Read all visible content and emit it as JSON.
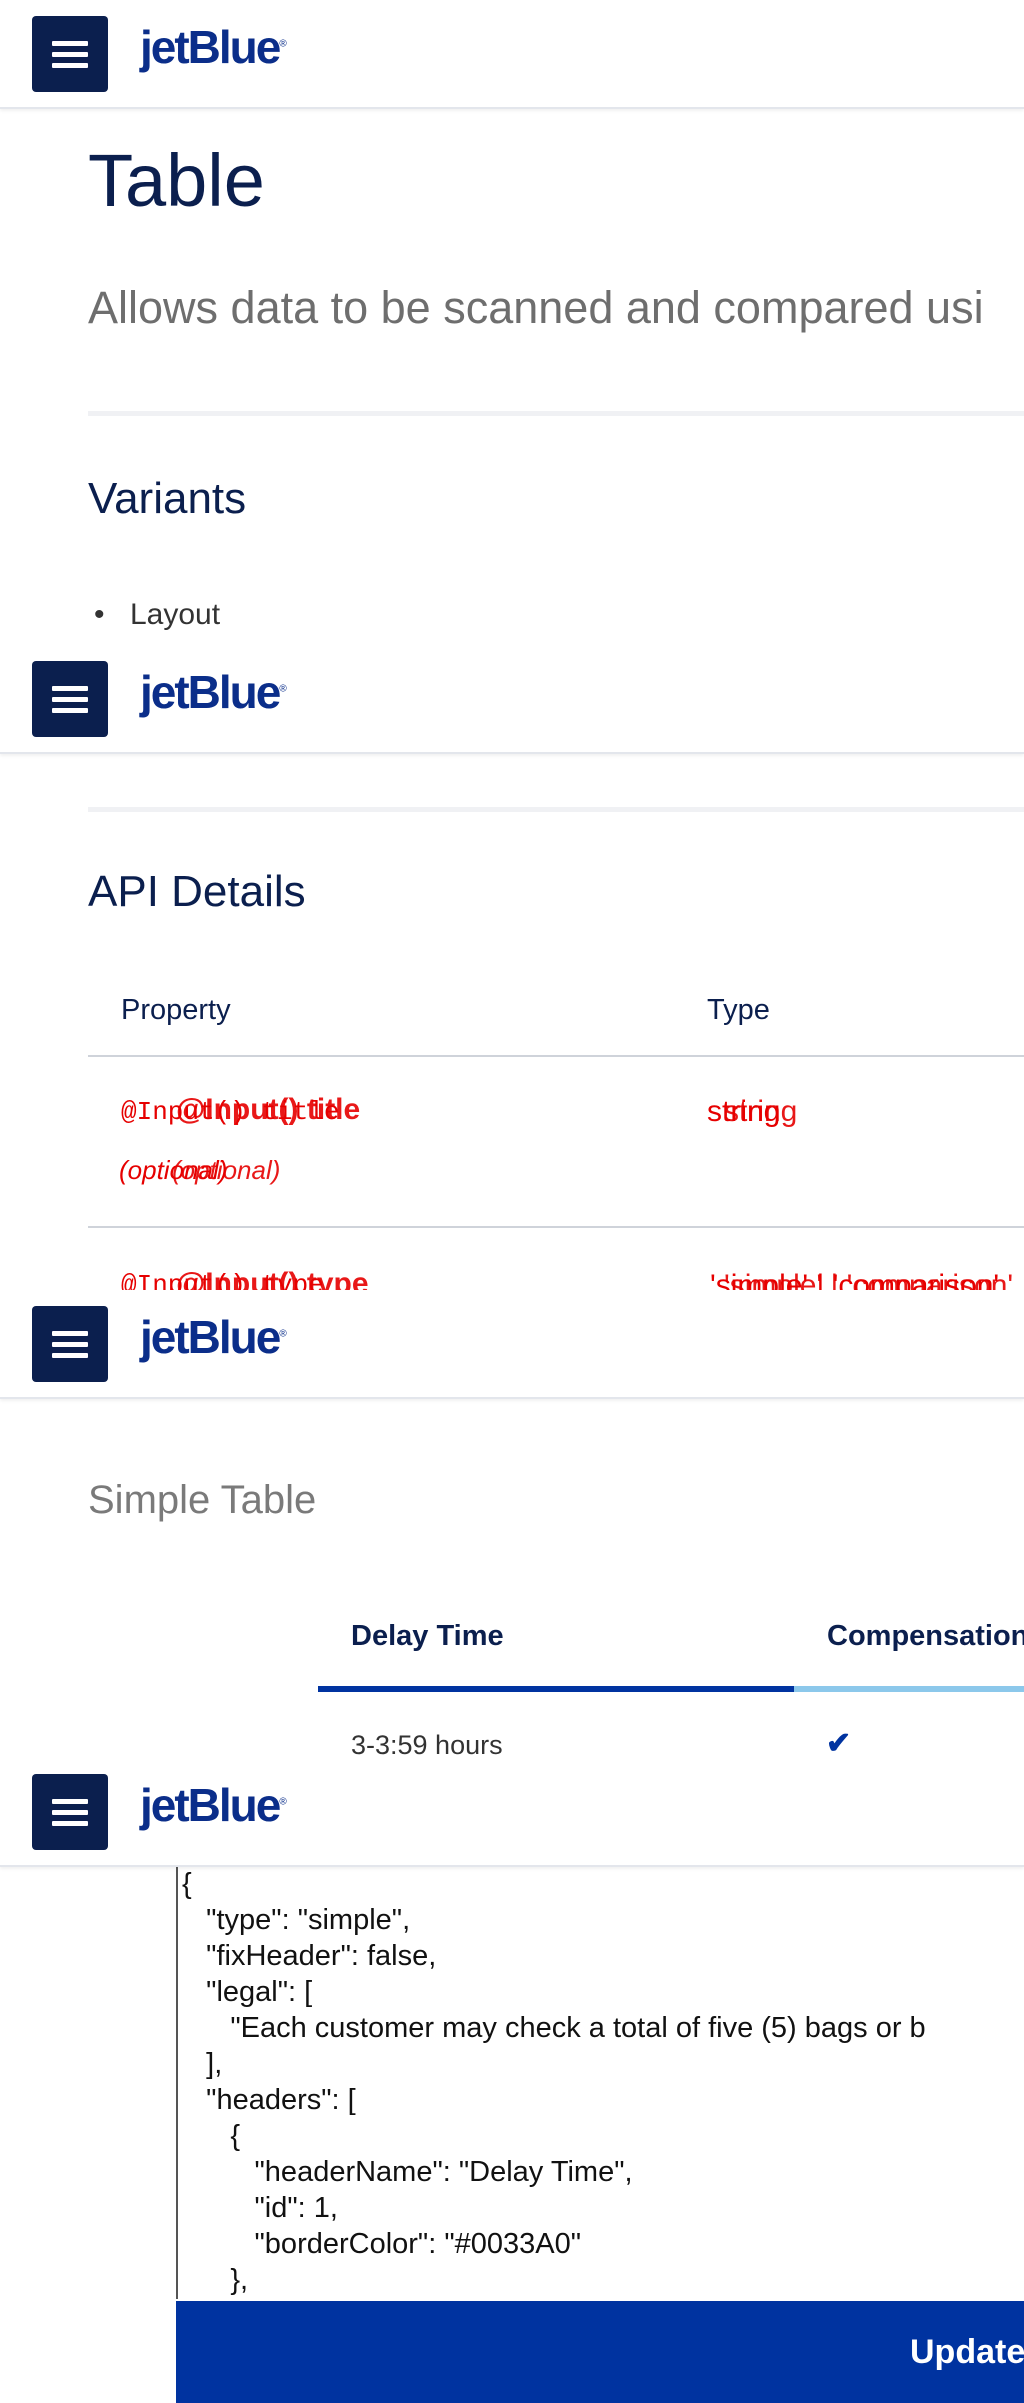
{
  "brand": {
    "logo_text": "jetBlue",
    "menu_icon": "hamburger-menu-icon"
  },
  "page": {
    "title": "Table",
    "intro": "Allows data to be scanned and compared usi",
    "variants_heading": "Variants",
    "variants_items": [
      "Layout"
    ]
  },
  "api": {
    "heading": "API Details",
    "columns": [
      "Property",
      "Type"
    ],
    "rows": [
      {
        "property": "@Input() title",
        "optional": "(optional)",
        "type": "string"
      },
      {
        "property": "@Input() type",
        "type": "'simple' | 'comparison'"
      }
    ]
  },
  "simple_table": {
    "heading": "Simple Table",
    "headers": [
      "Delay Time",
      "Compensation"
    ],
    "header_colors": [
      "#0033A0",
      "#8CC8EB"
    ],
    "rows": [
      {
        "delay": "3-3:59 hours",
        "compensation_icon": "checkmark-icon"
      }
    ]
  },
  "editor": {
    "lines": [
      "{",
      "   \"type\": \"simple\",",
      "   \"fixHeader\": false,",
      "   \"legal\": [",
      "      \"Each customer may check a total of five (5) bags or b",
      "   ],",
      "   \"headers\": [",
      "      {",
      "         \"headerName\": \"Delay Time\",",
      "         \"id\": 1,",
      "         \"borderColor\": \"#0033A0\"",
      "      },"
    ],
    "update_label": "Update"
  },
  "colors": {
    "navy": "#0b1f4e",
    "brand_blue": "#0033a0",
    "accent_red": "#e60000"
  }
}
